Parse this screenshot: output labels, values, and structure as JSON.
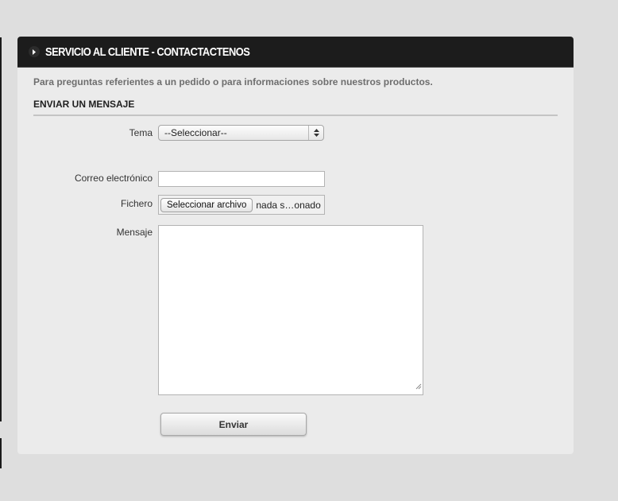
{
  "panel": {
    "title": "SERVICIO AL CLIENTE - CONTACTACTENOS",
    "intro": "Para preguntas referientes a un pedido o para informaciones sobre nuestros productos.",
    "section_heading": "ENVIAR UN MENSAJE"
  },
  "form": {
    "topic_label": "Tema",
    "topic_selected": "--Seleccionar--",
    "email_label": "Correo electrónico",
    "email_value": "",
    "file_label": "Fichero",
    "file_button_label": "Seleccionar archivo",
    "file_status": "nada s…onado",
    "message_label": "Mensaje",
    "message_value": "",
    "submit_label": "Enviar"
  },
  "icons": {
    "header_arrow": "chevron-right-icon",
    "select_arrows": "up-down-arrows-icon",
    "resize": "resize-handle-icon"
  },
  "colors": {
    "header_bg": "#1c1c1c",
    "panel_bg": "#ebebeb",
    "page_bg": "#dedede"
  }
}
